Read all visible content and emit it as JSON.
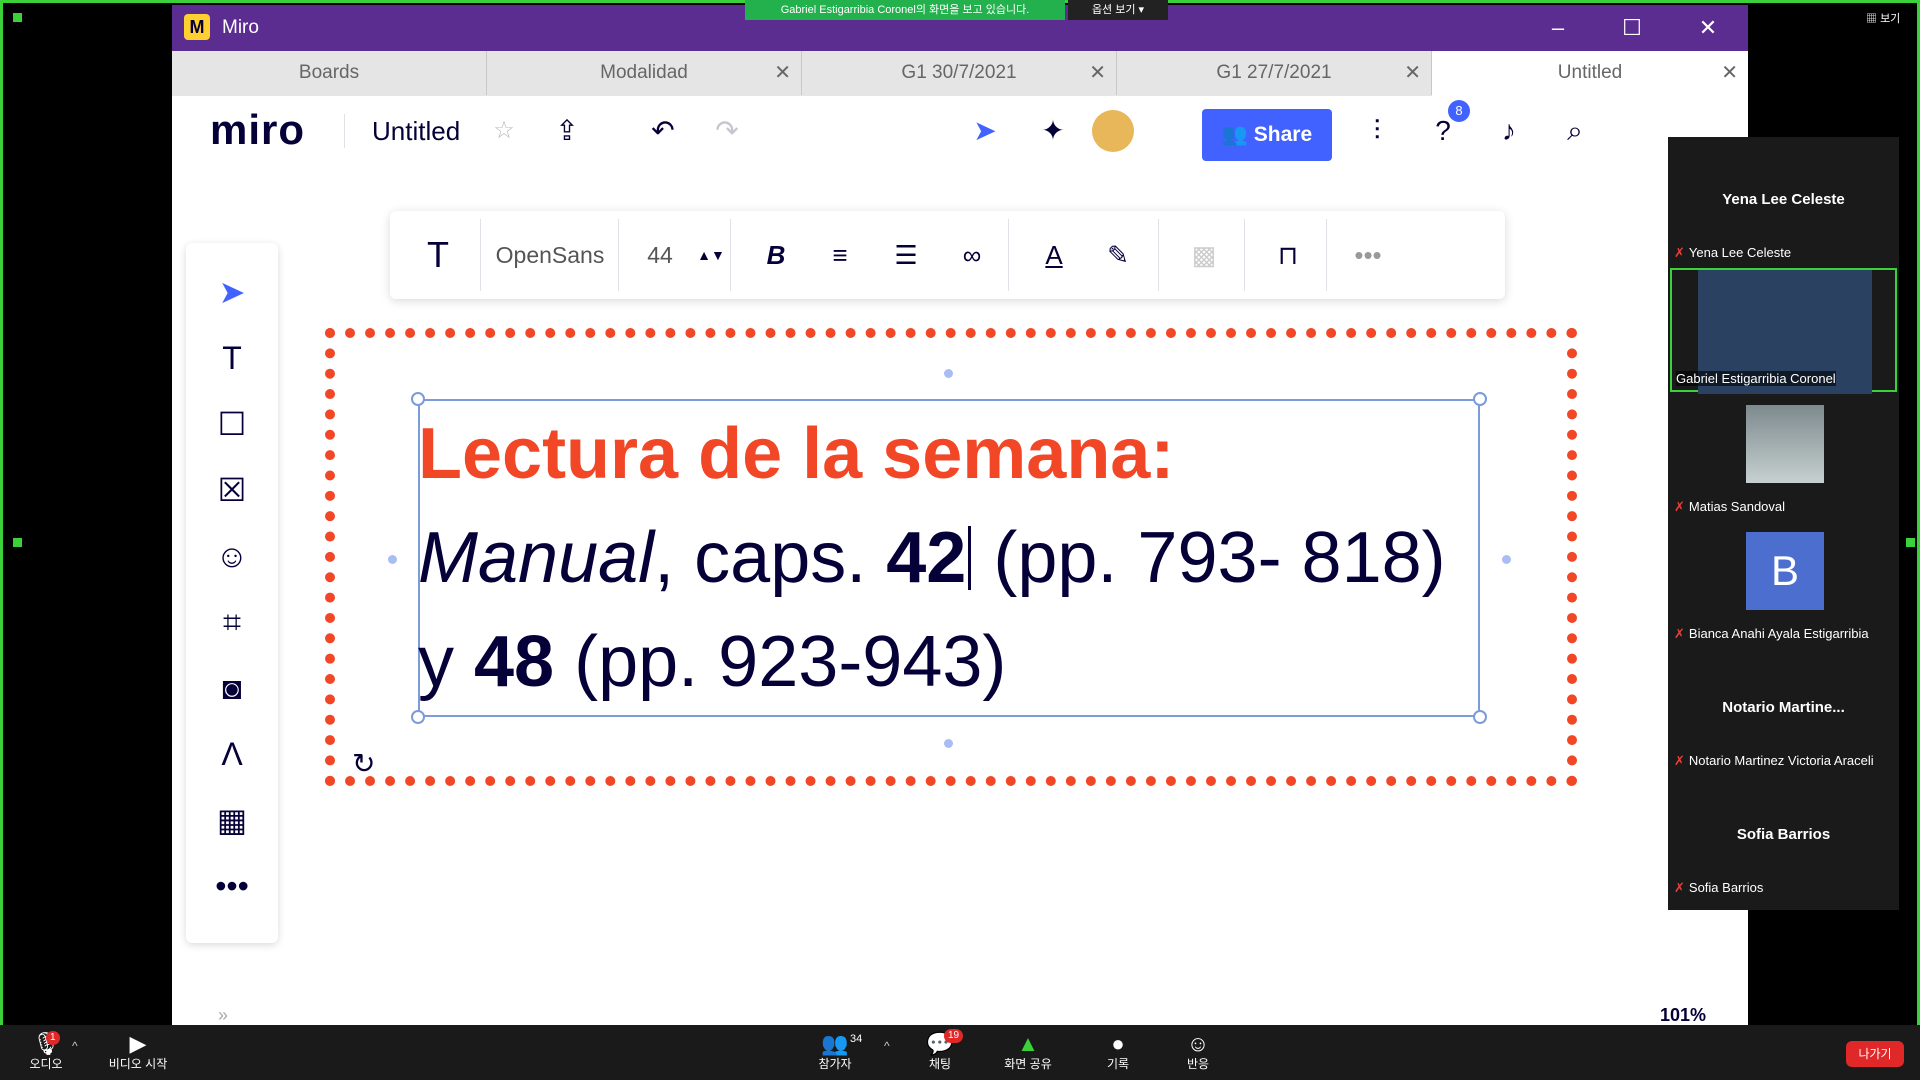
{
  "sharing_banner": "Gabriel Estigarribia Coronel의 화면을 보고 있습니다.",
  "sharing_options": "옵션 보기",
  "window": {
    "app_name": "Miro"
  },
  "tabs": [
    {
      "label": "Boards"
    },
    {
      "label": "Modalidad"
    },
    {
      "label": "G1 30/7/2021"
    },
    {
      "label": "G1 27/7/2021"
    },
    {
      "label": "Untitled"
    }
  ],
  "header": {
    "brand": "miro",
    "board_name": "Untitled",
    "share_label": "Share",
    "help_badge": "8"
  },
  "context_toolbar": {
    "font": "OpenSans",
    "size": "44"
  },
  "canvas": {
    "line1": "Lectura de la semana:",
    "line2_italic": "Manual",
    "line2_a": ", caps. ",
    "line2_bold": "42",
    "line2_b": " (pp. 793- 818)",
    "line3_a": "y ",
    "line3_bold": "48",
    "line3_b": " (pp. 923-943)",
    "zoom": "101%"
  },
  "participants": [
    {
      "center": "Yena Lee Celeste",
      "label": "Yena Lee Celeste"
    },
    {
      "label": "Gabriel Estigarribia Coronel"
    },
    {
      "label": "Matias Sandoval"
    },
    {
      "avatar": "B",
      "label": "Bianca Anahi  Ayala Estigarribia"
    },
    {
      "center": "Notario  Martine...",
      "label": "Notario Martinez Victoria Araceli"
    },
    {
      "center": "Sofia Barrios",
      "label": "Sofia Barrios"
    }
  ],
  "zoom_bar": {
    "audio": "오디오",
    "audio_badge": "1",
    "video": "비디오 시작",
    "participants": "참가자",
    "participants_count": "34",
    "chat": "채팅",
    "chat_badge": "19",
    "share": "화면 공유",
    "record": "기록",
    "reactions": "반응",
    "leave": "나가기",
    "view": "보기"
  }
}
